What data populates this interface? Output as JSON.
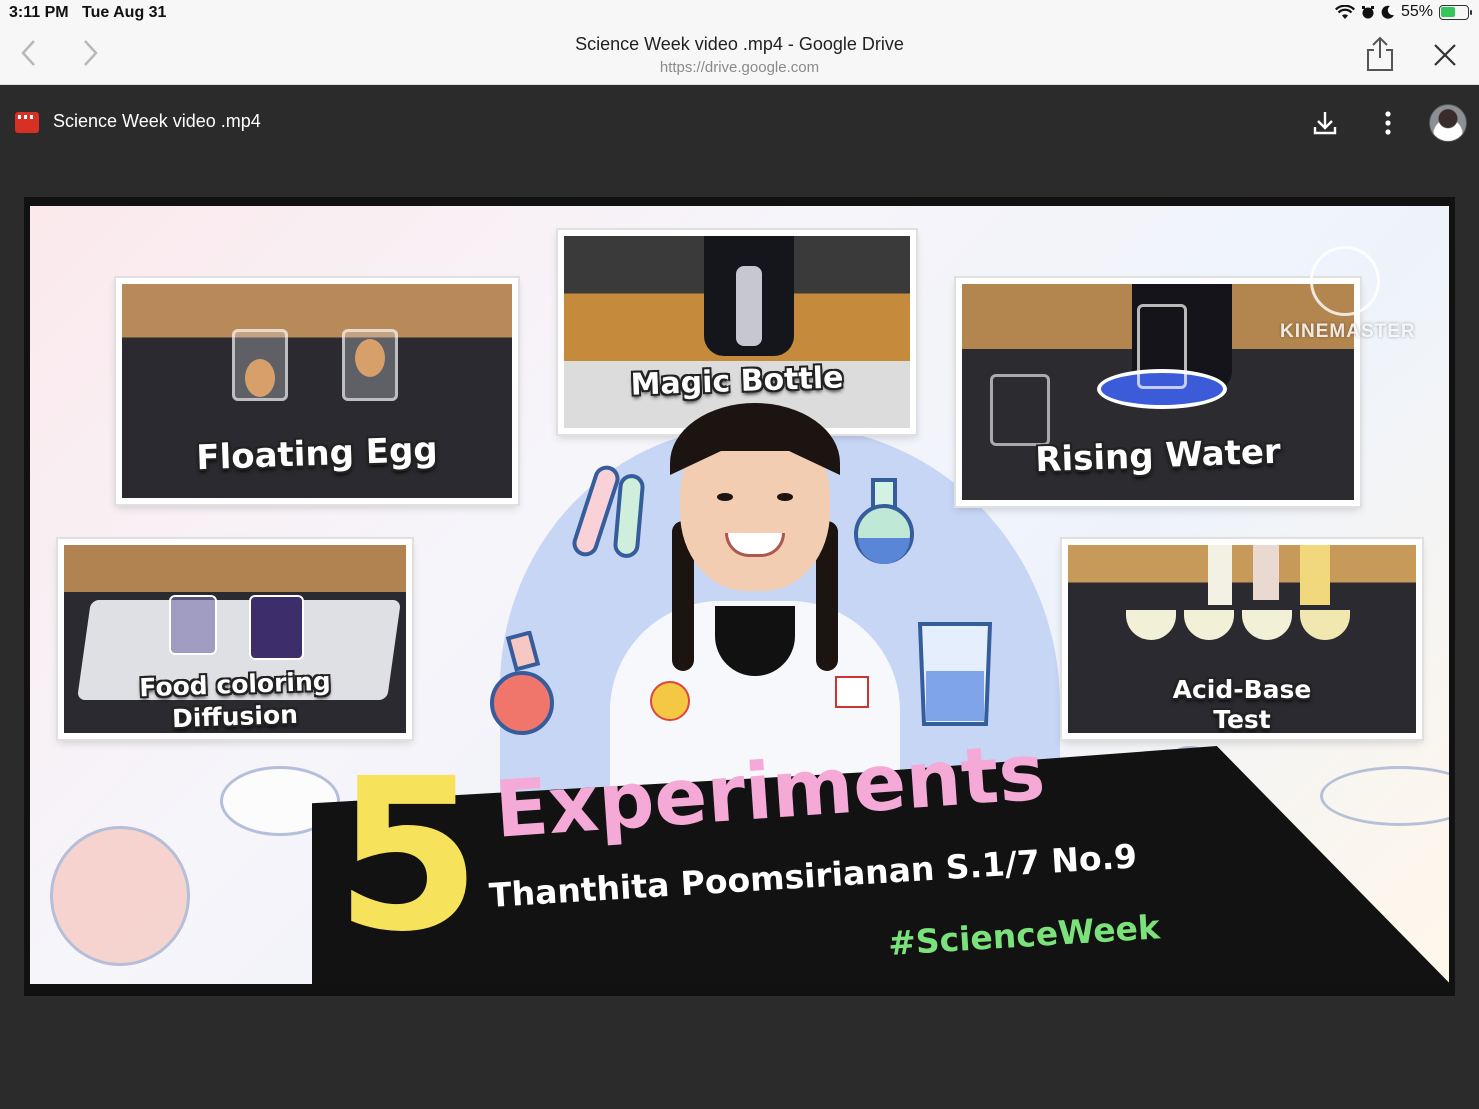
{
  "status_bar": {
    "time": "3:11 PM",
    "date": "Tue Aug 31",
    "battery": "55%",
    "battery_level": 0.55
  },
  "browser": {
    "title": "Science Week video .mp4 - Google Drive",
    "url": "https://drive.google.com"
  },
  "drive": {
    "file_name": "Science Week video .mp4"
  },
  "video": {
    "thumbnails": [
      {
        "label": "Floating Egg"
      },
      {
        "label": "Magic Bottle"
      },
      {
        "label": "Rising Water"
      },
      {
        "label": "Food coloring",
        "label2": "Diffusion"
      },
      {
        "label": "Acid-Base",
        "label2": "Test"
      }
    ],
    "number": "5",
    "headline": "Experiments",
    "byline": "Thanthita Poomsirianan S.1/7 No.9",
    "hashtag": "#ScienceWeek",
    "watermark": "KINEMASTER"
  },
  "colors": {
    "drive_bg": "#2b2b2b",
    "battery_green": "#34c759",
    "headline_pink": "#f4a9d6",
    "number_yellow": "#f7e25c",
    "hashtag_green": "#7be27b"
  }
}
